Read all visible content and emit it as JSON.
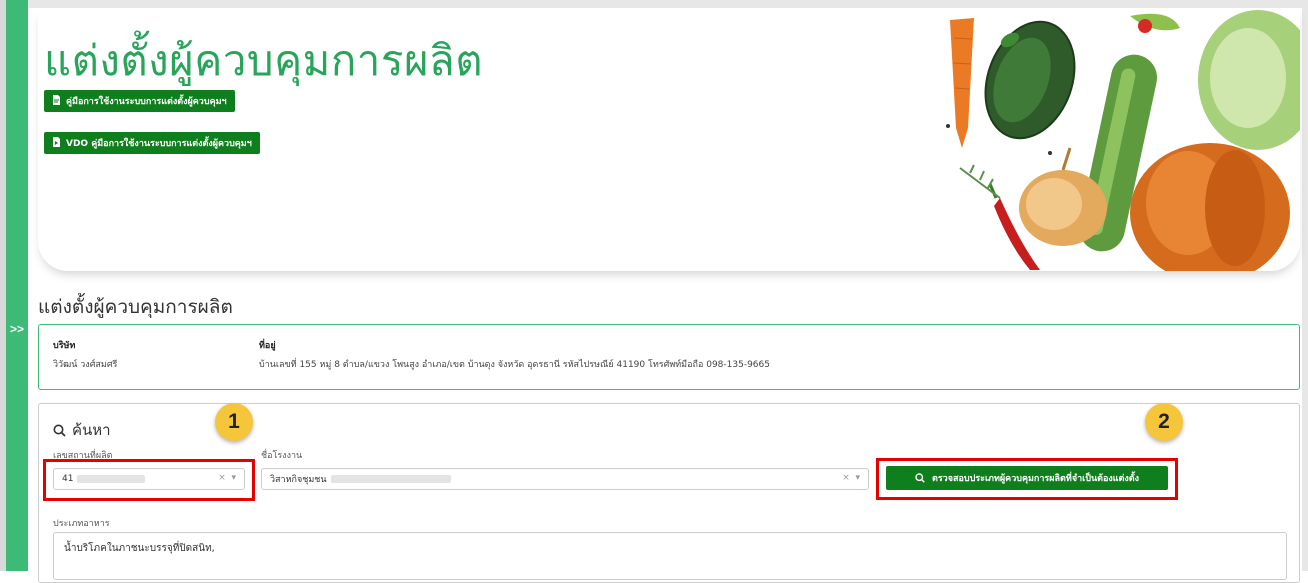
{
  "hero": {
    "title": "แต่งตั้งผู้ควบคุมการผลิต",
    "manual_button": "คู่มือการใช้งานระบบการแต่งตั้งผู้ควบคุมฯ",
    "vdo_button": "VDO คู่มือการใช้งานระบบการแต่งตั้งผู้ควบคุมฯ"
  },
  "sidebar": {
    "toggle_label": ">>"
  },
  "section": {
    "title": "แต่งตั้งผู้ควบคุมการผลิต"
  },
  "company": {
    "company_label": "บริษัท",
    "company_value": "วิวัฒน์ วงศ์สมศรี",
    "address_label": "ที่อยู่",
    "address_value": "บ้านเลขที่ 155 หมู่ 8 ตำบล/แขวง โพนสูง อำเภอ/เขต บ้านดุง จังหวัด อุดรธานี รหัสไปรษณีย์ 41190 โทรศัพท์มือถือ 098-135-9665"
  },
  "search": {
    "heading": "ค้นหา",
    "license_label": "เลขสถานที่ผลิต",
    "license_value": "41",
    "factory_label": "ชื่อโรงงาน",
    "factory_value": "วิสาหกิจชุมชน",
    "check_button": "ตรวจสอบประเภทผู้ควบคุมการผลิตที่จำเป็นต้องแต่งตั้ง",
    "food_type_label": "ประเภทอาหาร",
    "food_type_value": "น้ำบริโภคในภาชนะบรรจุที่ปิดสนิท,"
  },
  "annotations": {
    "badge_1": "1",
    "badge_2": "2"
  },
  "colors": {
    "brand_green": "#3dba75",
    "button_green": "#0f7e1d",
    "title_green": "#28a55a",
    "highlight_red": "#e60000",
    "badge_yellow": "#f5c53a"
  },
  "icons": {
    "manual": "file-icon",
    "vdo": "video-file-icon",
    "search": "search-icon",
    "clear": "clear-icon",
    "dropdown": "chevron-down-icon"
  }
}
